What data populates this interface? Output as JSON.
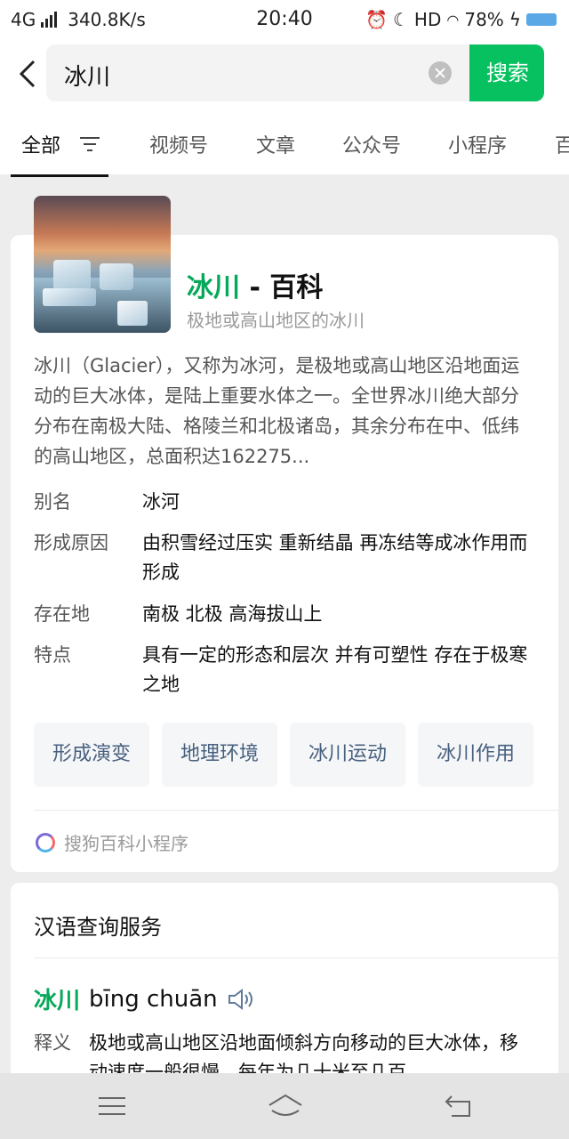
{
  "status_bar": {
    "network": "4G",
    "speed": "340.8K/s",
    "time": "20:40",
    "hd": "HD",
    "battery": "78%"
  },
  "search": {
    "query": "冰川",
    "button": "搜索"
  },
  "tabs": [
    "全部",
    "视频号",
    "文章",
    "公众号",
    "小程序",
    "百"
  ],
  "baike": {
    "title_keyword": "冰川",
    "title_suffix": " - 百科",
    "subtitle": "极地或高山地区的冰川",
    "description": "冰川（Glacier），又称为冰河，是极地或高山地区沿地面运动的巨大冰体，是陆上重要水体之一。全世界冰川绝大部分分布在南极大陆、格陵兰和北极诸岛，其余分布在中、低纬的高山地区，总面积达162275...",
    "facts": [
      {
        "key": "别名",
        "value": "冰河"
      },
      {
        "key": "形成原因",
        "value": "由积雪经过压实   重新结晶   再冻结等成冰作用而形成"
      },
      {
        "key": "存在地",
        "value": "南极   北极   高海拔山上"
      },
      {
        "key": "特点",
        "value": "具有一定的形态和层次   并有可塑性   存在于极寒之地"
      }
    ],
    "chips": [
      "形成演变",
      "地理环境",
      "冰川运动",
      "冰川作用"
    ],
    "source": "搜狗百科小程序"
  },
  "dictionary": {
    "title": "汉语查询服务",
    "word": "冰川",
    "pinyin": "bīng chuān",
    "definition_label": "释义",
    "definition": "极地或高山地区沿地面倾斜方向移动的巨大冰体，移动速度一般很慢，每年为几十米至几百"
  },
  "colors": {
    "accent_green": "#07c160",
    "chip_text": "#47607f"
  }
}
